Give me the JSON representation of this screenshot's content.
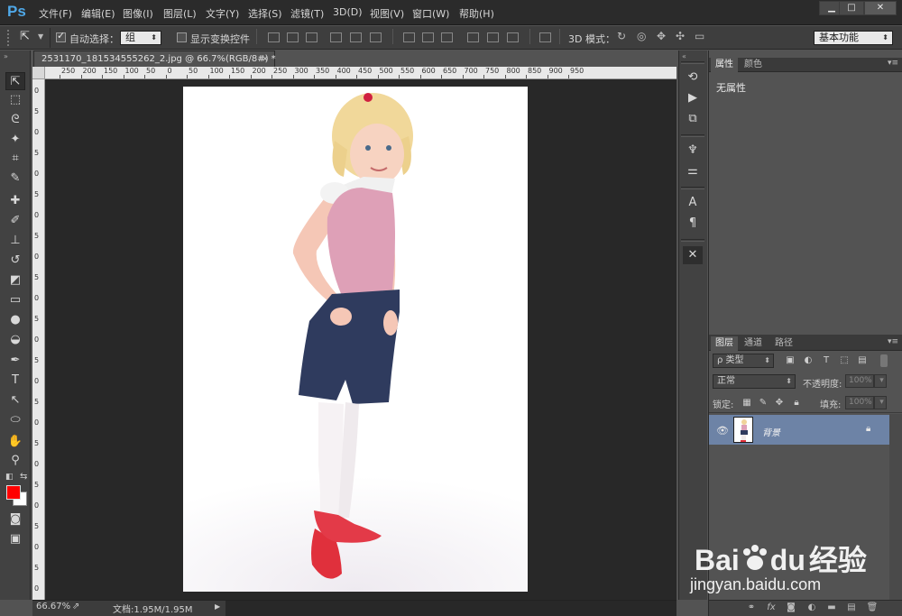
{
  "app": {
    "logo": "Ps",
    "menu": [
      "文件(F)",
      "编辑(E)",
      "图像(I)",
      "图层(L)",
      "文字(Y)",
      "选择(S)",
      "滤镜(T)",
      "3D(D)",
      "视图(V)",
      "窗口(W)",
      "帮助(H)"
    ],
    "window_controls": {
      "minimize": "▁",
      "maximize": "□",
      "close": "✕"
    }
  },
  "options_bar": {
    "auto_select_label": "自动选择：",
    "auto_select_checked": true,
    "auto_select_target": "组",
    "show_transform_label": "显示变换控件",
    "show_transform_checked": false,
    "mode_3d_label": "3D 模式：",
    "workspace": "基本功能"
  },
  "document": {
    "tab_title": "2531170_181534555262_2.jpg @ 66.7%(RGB/8#) *",
    "tab_close": "×",
    "ruler_h_labels": [
      "250",
      "200",
      "150",
      "100",
      "50",
      "0",
      "50",
      "100",
      "150",
      "200",
      "250",
      "300",
      "350",
      "400",
      "450",
      "500",
      "550",
      "600",
      "650",
      "700",
      "750",
      "800",
      "850",
      "900",
      "950"
    ],
    "ruler_v_labels": [
      "0",
      "5",
      "0",
      "5",
      "0",
      "5",
      "0",
      "5",
      "0",
      "5",
      "0",
      "5",
      "0",
      "5",
      "0",
      "5",
      "0",
      "5",
      "0",
      "5",
      "0",
      "5",
      "0",
      "5",
      "0"
    ]
  },
  "status": {
    "zoom": "66.67%",
    "doc_size": "文档:1.95M/1.95M",
    "arrow": "▶"
  },
  "tools": [
    "move-tool",
    "marquee-tool",
    "lasso-tool",
    "magic-wand-tool",
    "crop-tool",
    "eyedropper-tool",
    "healing-brush-tool",
    "brush-tool",
    "clone-stamp-tool",
    "history-brush-tool",
    "eraser-tool",
    "gradient-tool",
    "blur-tool",
    "dodge-tool",
    "pen-tool",
    "type-tool",
    "path-selection-tool",
    "ellipse-tool",
    "hand-tool",
    "zoom-tool"
  ],
  "colors": {
    "foreground": "#ff0000",
    "background": "#ffffff",
    "accent_ps_logo": "#4fa8e8",
    "selected_layer": "#6d83a6"
  },
  "properties_panel": {
    "tabs": [
      "属性",
      "颜色"
    ],
    "active_tab": "属性",
    "empty_text": "无属性"
  },
  "layers_panel": {
    "tabs": [
      "图层",
      "通道",
      "路径"
    ],
    "active_tab": "图层",
    "filter_kind": "ρ 类型",
    "blend_mode": "正常",
    "opacity_label": "不透明度:",
    "opacity_value": "100%",
    "lock_label": "锁定:",
    "fill_label": "填充:",
    "fill_value": "100%",
    "layers": [
      {
        "name": "背景",
        "visible": true,
        "locked": true,
        "selected": true
      }
    ],
    "footer_icons": [
      "link-icon",
      "fx-icon",
      "mask-icon",
      "adjustment-icon",
      "folder-icon",
      "new-layer-icon",
      "trash-icon"
    ]
  },
  "watermark": {
    "brand": "Bai",
    "brand_tail": "du",
    "brand_cn": "经验",
    "url": "jingyan.baidu.com"
  }
}
